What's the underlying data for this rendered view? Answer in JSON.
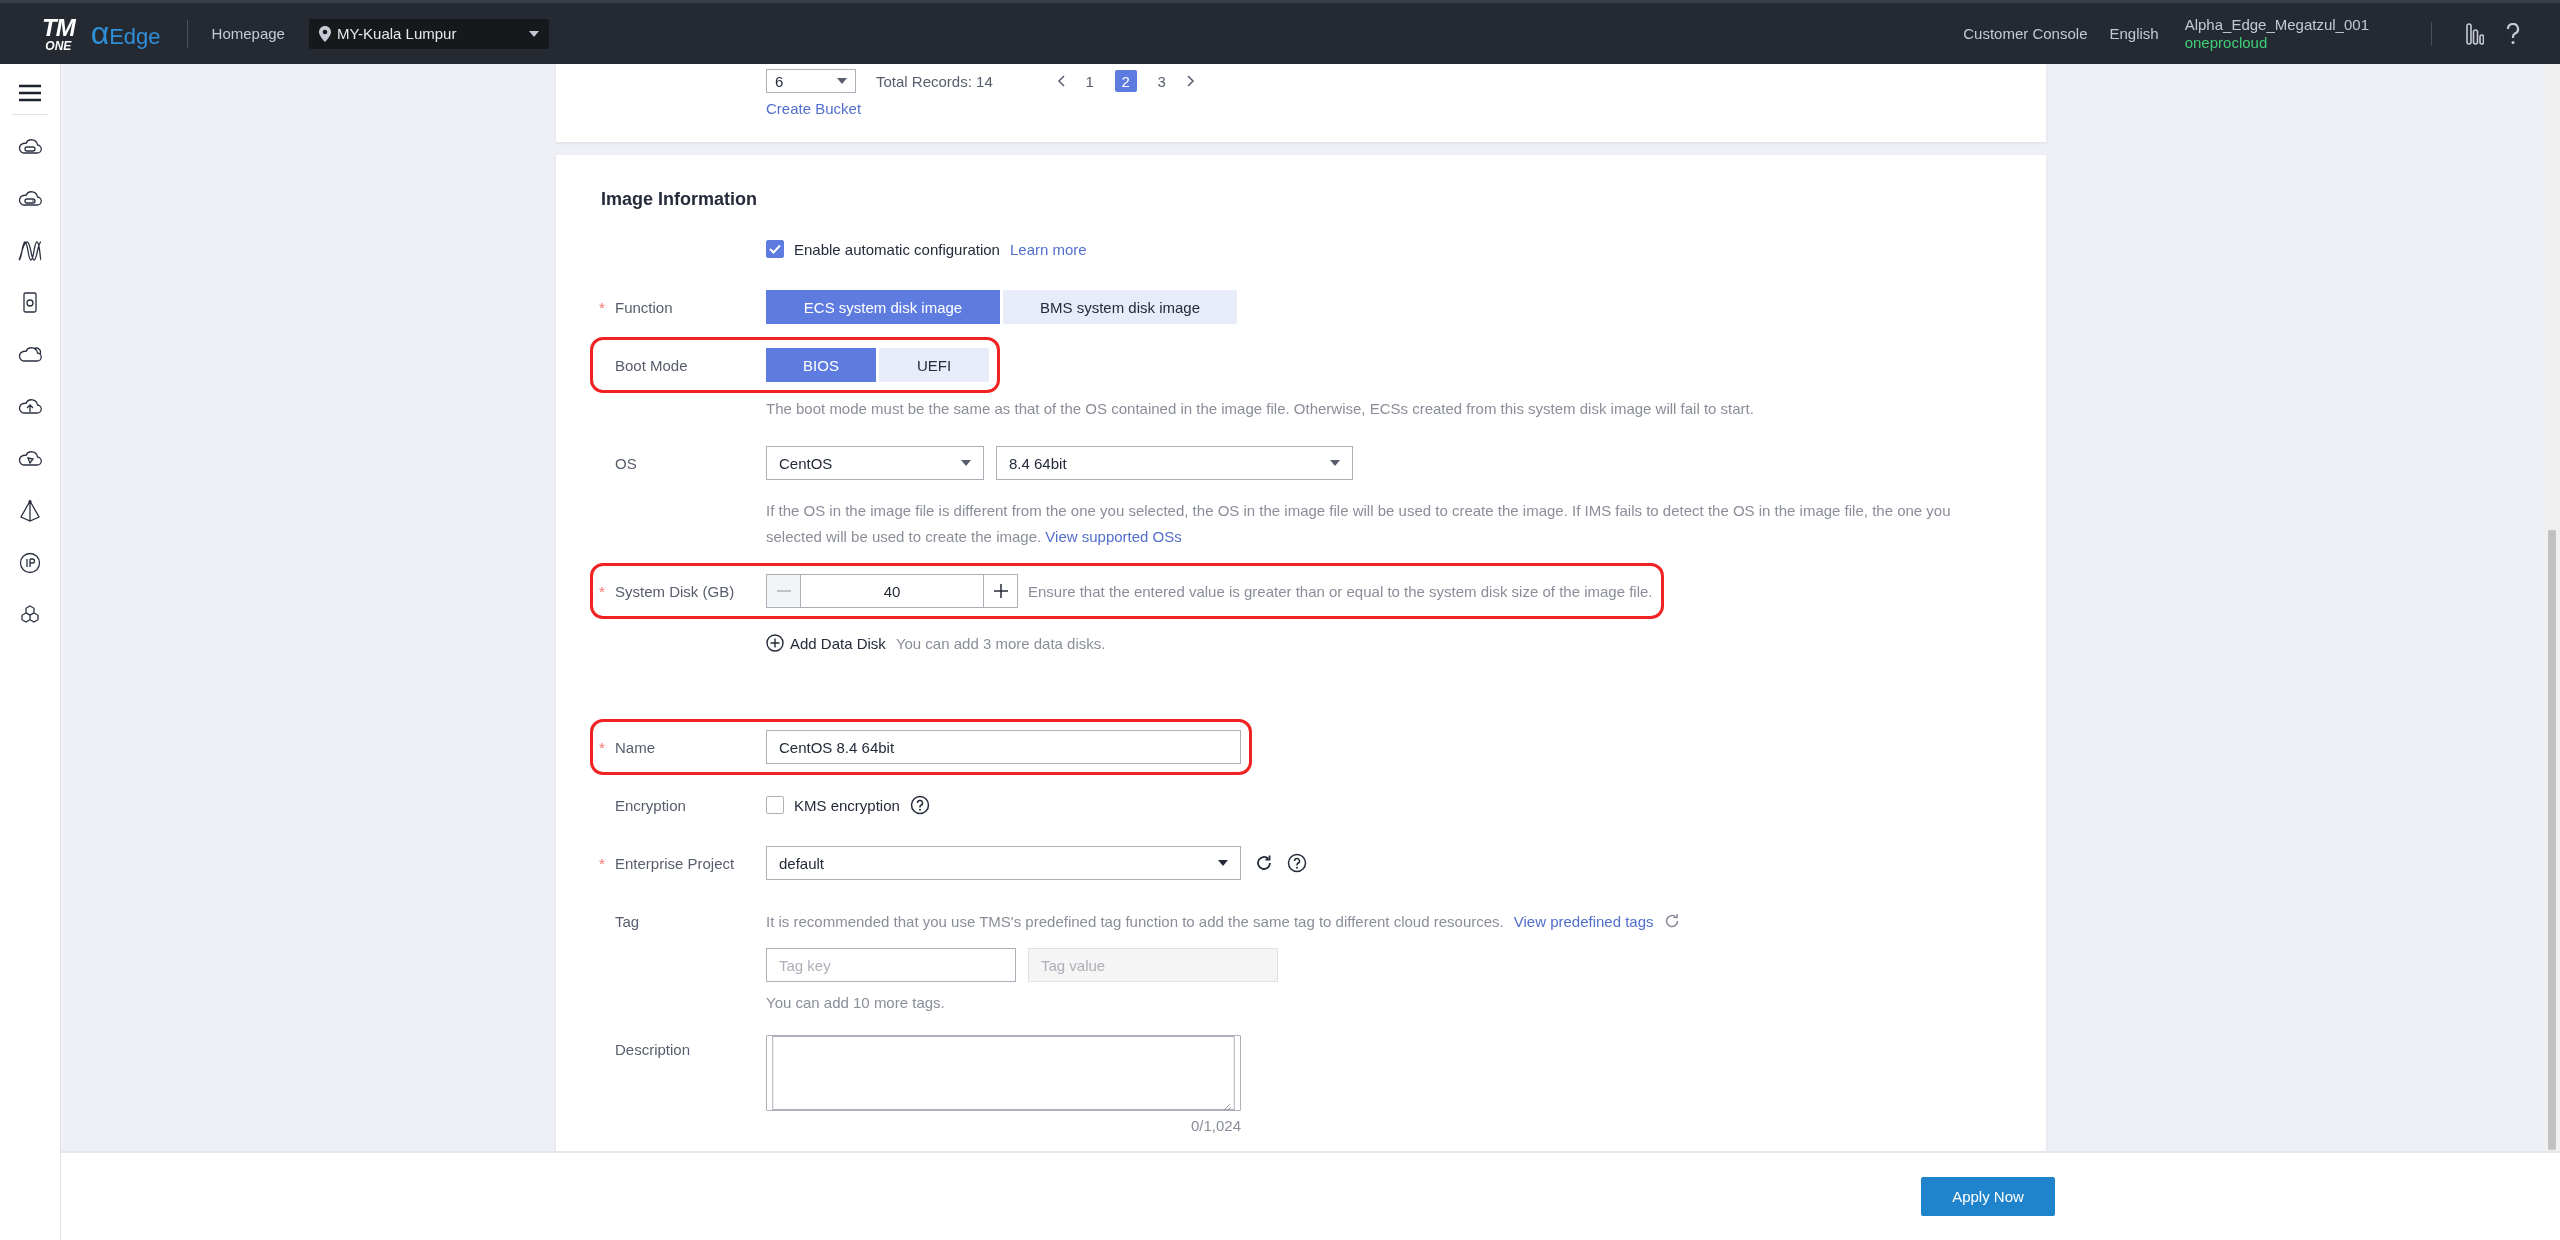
{
  "header": {
    "logo": {
      "top": "TM",
      "bottom": "ONE"
    },
    "product": {
      "symbol": "α",
      "name": "Edge"
    },
    "home_link": "Homepage",
    "region": {
      "value": "MY-Kuala Lumpur"
    },
    "console_link": "Customer Console",
    "language": "English",
    "user": {
      "name": "Alpha_Edge_Megatzul_001",
      "account": "oneprocloud"
    }
  },
  "bucket_panel": {
    "page_size": "6",
    "total": "Total Records: 14",
    "pages": [
      {
        "label": "1",
        "selected": false
      },
      {
        "label": "2",
        "selected": true
      },
      {
        "label": "3",
        "selected": false
      }
    ],
    "create_link": "Create Bucket"
  },
  "image_panel": {
    "title": "Image Information",
    "rows": [
      {
        "kind": "checkbox",
        "highlighted": false,
        "checked": true,
        "text": "Enable automatic configuration",
        "link": "Learn more",
        "help": false
      },
      {
        "kind": "segmented",
        "label": "Function",
        "required_mark": "*",
        "highlighted": false,
        "options": [
          {
            "label": "ECS system disk image",
            "selected": true
          },
          {
            "label": "BMS system disk image",
            "selected": false
          }
        ]
      },
      {
        "kind": "segmented",
        "label": "Boot Mode",
        "highlighted": true,
        "options": [
          {
            "label": "BIOS",
            "selected": true
          },
          {
            "label": "UEFI",
            "selected": false
          }
        ],
        "hint": "The boot mode must be the same as that of the OS contained in the image file. Otherwise, ECSs created from this system disk image will fail to start."
      },
      {
        "kind": "select_pair",
        "label": "OS",
        "highlighted": false,
        "selects": [
          "CentOS",
          "8.4 64bit"
        ],
        "hint": "If the OS in the image file is different from the one you selected, the OS in the image file will be used to create the image. If IMS fails to detect the OS in the image file, the one you selected will be used to create the image.",
        "hint_link": "View supported OSs"
      },
      {
        "kind": "stepper",
        "label": "System Disk (GB)",
        "required_mark": "*",
        "highlighted": true,
        "value": "40",
        "note": "Ensure that the entered value is greater than or equal to the system disk size of the image file."
      },
      {
        "kind": "add",
        "highlighted": false,
        "text": "Add Data Disk",
        "note": "You can add 3 more data disks."
      },
      {
        "kind": "input",
        "label": "Name",
        "required_mark": "*",
        "highlighted": true,
        "value": "CentOS 8.4 64bit"
      },
      {
        "kind": "checkbox",
        "label": "Encryption",
        "highlighted": false,
        "checked": false,
        "text": "KMS encryption",
        "help": true
      },
      {
        "kind": "select",
        "label": "Enterprise Project",
        "required_mark": "*",
        "highlighted": false,
        "value": "default"
      },
      {
        "kind": "tag",
        "label": "Tag",
        "highlighted": false,
        "hint": "It is recommended that you use TMS's predefined tag function to add the same tag to different cloud resources.",
        "hint_link": "View predefined tags",
        "key_placeholder": "Tag key",
        "value_placeholder": "Tag value",
        "note": "You can add 10 more tags."
      },
      {
        "kind": "textarea",
        "label": "Description",
        "highlighted": false,
        "counter": "0/1,024"
      }
    ]
  },
  "footer": {
    "apply_button": "Apply Now"
  }
}
